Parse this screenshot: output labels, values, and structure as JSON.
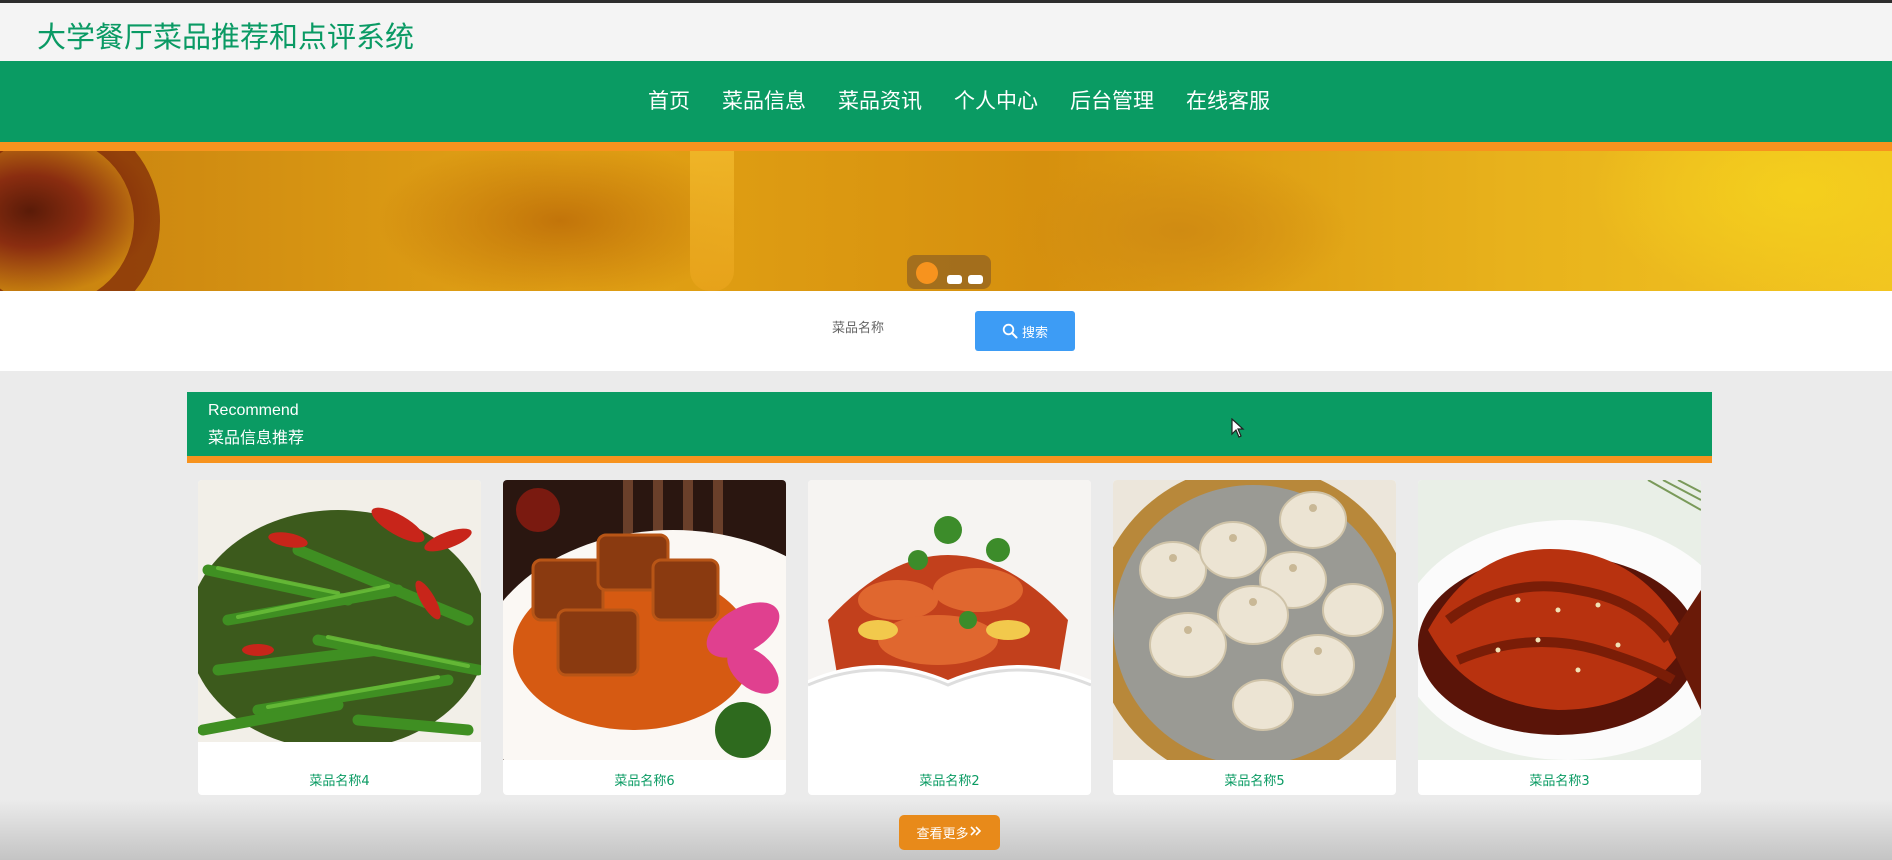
{
  "site": {
    "title": "大学餐厅菜品推荐和点评系统"
  },
  "nav": {
    "items": [
      {
        "label": "首页"
      },
      {
        "label": "菜品信息"
      },
      {
        "label": "菜品资讯"
      },
      {
        "label": "个人中心"
      },
      {
        "label": "后台管理"
      },
      {
        "label": "在线客服"
      }
    ]
  },
  "carousel": {
    "slide_count": 3,
    "active_index": 0
  },
  "search": {
    "placeholder": "菜品名称",
    "button_label": "搜索"
  },
  "recommend": {
    "title_en": "Recommend",
    "title_cn": "菜品信息推荐",
    "items": [
      {
        "name": "菜品名称4",
        "image": "green-beans-chili"
      },
      {
        "name": "菜品名称6",
        "image": "braised-pork"
      },
      {
        "name": "菜品名称2",
        "image": "spicy-salad"
      },
      {
        "name": "菜品名称5",
        "image": "soup-dumplings"
      },
      {
        "name": "菜品名称3",
        "image": "sweet-sour-fish"
      }
    ],
    "more_label": "查看更多"
  },
  "colors": {
    "brand_green": "#0a9b63",
    "accent_orange": "#f7931e",
    "search_blue": "#3d9cf5"
  }
}
